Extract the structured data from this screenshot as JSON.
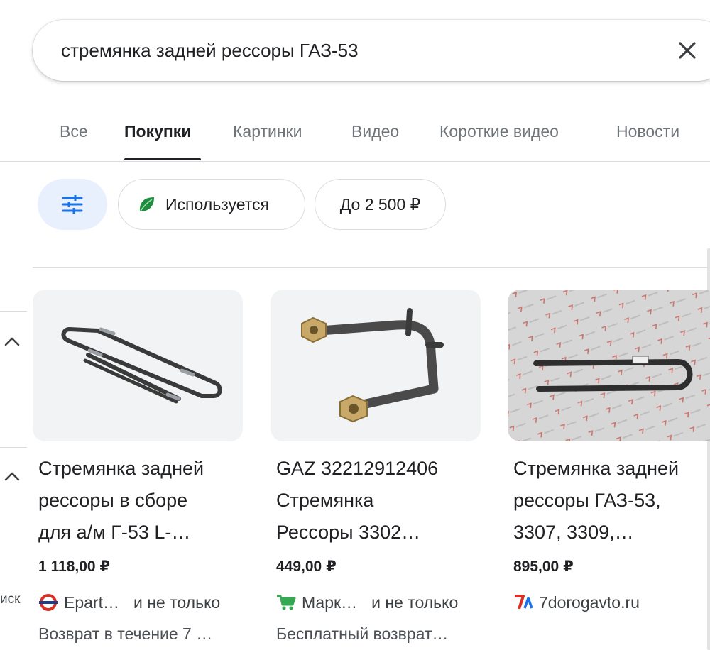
{
  "search": {
    "query": "стремянка задней рессоры ГАЗ-53"
  },
  "tabs": [
    {
      "label": "Все"
    },
    {
      "label": "Покупки",
      "active": true
    },
    {
      "label": "Картинки"
    },
    {
      "label": "Видео"
    },
    {
      "label": "Короткие видео"
    },
    {
      "label": "Новости"
    }
  ],
  "chips": {
    "used_label": "Используется",
    "price_label": "До 2 500 ₽"
  },
  "left_rail": {
    "partial_text": "иск"
  },
  "products": [
    {
      "title_lines": [
        "Стремянка задней",
        "рессоры в сборе",
        "для а/м Г-53 L-…"
      ],
      "price": "1 118,00 ₽",
      "seller": "Epart…",
      "seller_extra": "и не только",
      "note": "Возврат в течение 7 …"
    },
    {
      "title_lines": [
        "GAZ 32212912406",
        "Стремянка",
        "Рессоры 3302…"
      ],
      "price": "449,00 ₽",
      "seller": "Марк…",
      "seller_extra": "и не только",
      "note": "Бесплатный возврат…"
    },
    {
      "title_lines": [
        "Стремянка задней",
        "рессоры ГАЗ-53,",
        "3307, 3309,…"
      ],
      "price": "895,00 ₽",
      "seller": "7dorogavto.ru",
      "seller_extra": "",
      "note": ""
    }
  ],
  "colors": {
    "filter_chip_bg": "#e8f0fe",
    "filter_icon": "#1a73e8",
    "leaf": "#1e8e3e",
    "epart": "#d93025",
    "market_cart": "#34a853"
  }
}
